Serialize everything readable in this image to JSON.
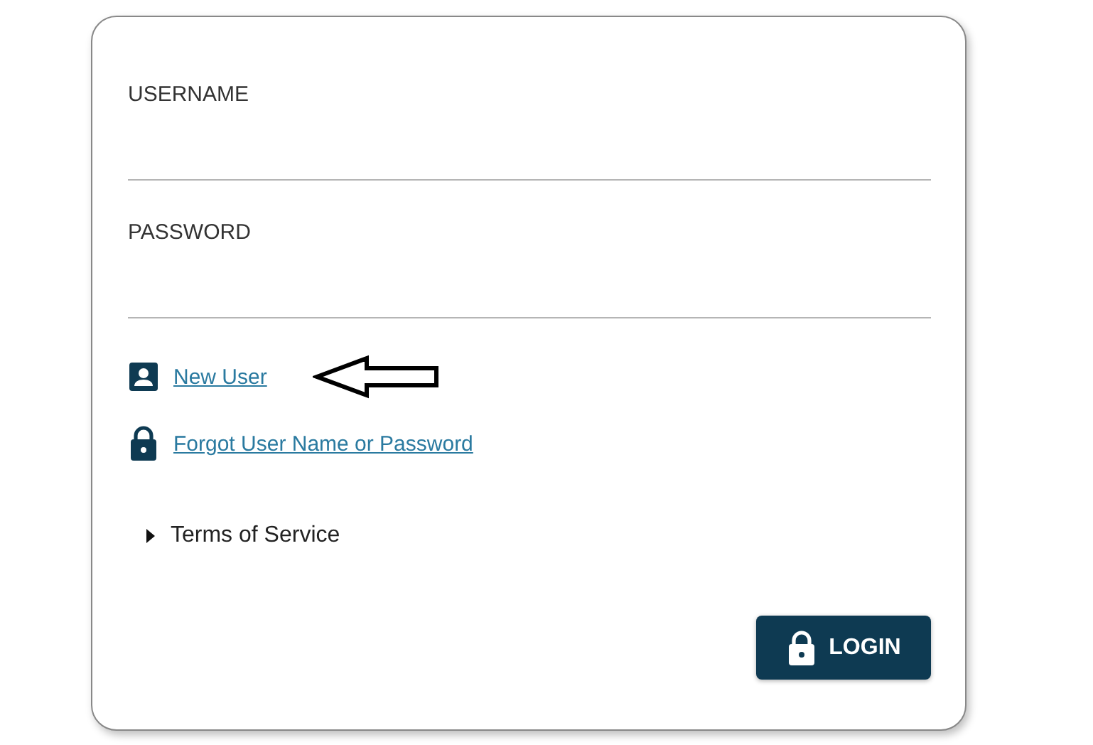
{
  "fields": [
    {
      "label": "USERNAME"
    },
    {
      "label": "PASSWORD"
    }
  ],
  "links": [
    {
      "label": "New User",
      "kind": "person",
      "annotated": true
    },
    {
      "label": "Forgot User Name or Password",
      "kind": "lock",
      "annotated": false
    }
  ],
  "terms": {
    "label": "Terms of Service",
    "expanded": false
  },
  "login_button": {
    "label": "LOGIN"
  }
}
